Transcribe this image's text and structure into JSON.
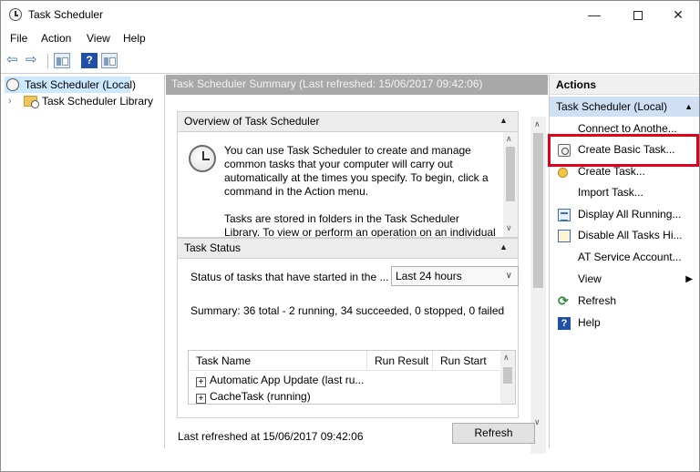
{
  "window": {
    "title": "Task Scheduler",
    "controls": {
      "minimize": "—",
      "close": "✕"
    }
  },
  "menu": [
    "File",
    "Action",
    "View",
    "Help"
  ],
  "toolbar": {
    "back": "⇦",
    "forward": "⇨",
    "help": "?"
  },
  "tree": {
    "root": "Task Scheduler (Local)",
    "chevron": "›",
    "library": "Task Scheduler Library"
  },
  "center": {
    "header": "Task Scheduler Summary (Last refreshed: 15/06/2017 09:42:06)",
    "overview": {
      "title": "Overview of Task Scheduler",
      "collapse": "▲",
      "para1": "You can use Task Scheduler to create and manage common tasks that your computer will carry out automatically at the times you specify. To begin, click a command in the Action menu.",
      "para2": "Tasks are stored in folders in the Task Scheduler Library. To view or perform an operation on an individual task,"
    },
    "status": {
      "title": "Task Status",
      "collapse": "▲",
      "label": "Status of tasks that have started in the ...",
      "period": "Last 24 hours",
      "summary": "Summary: 36 total - 2 running, 34 succeeded, 0 stopped, 0 failed",
      "columns": [
        "Task Name",
        "Run Result",
        "Run Start"
      ],
      "rows": [
        "Automatic App Update (last ru...",
        "CacheTask (running)"
      ]
    },
    "scroll": {
      "up": "∧",
      "down": "∨"
    },
    "footer": {
      "last_refreshed": "Last refreshed at 15/06/2017 09:42:06",
      "refresh_label": "Refresh"
    }
  },
  "actions": {
    "title": "Actions",
    "section": "Task Scheduler (Local)",
    "section_arrow": "▲",
    "items": [
      "Connect to Anothe...",
      "Create Basic Task...",
      "Create Task...",
      "Import Task...",
      "Display All Running...",
      "Disable All Tasks Hi...",
      "AT Service Account...",
      "View",
      "Refresh",
      "Help"
    ],
    "submenu_arrow": "▶"
  },
  "colors": {
    "highlight": "#e0001b",
    "accent": "#1f4fa8"
  }
}
